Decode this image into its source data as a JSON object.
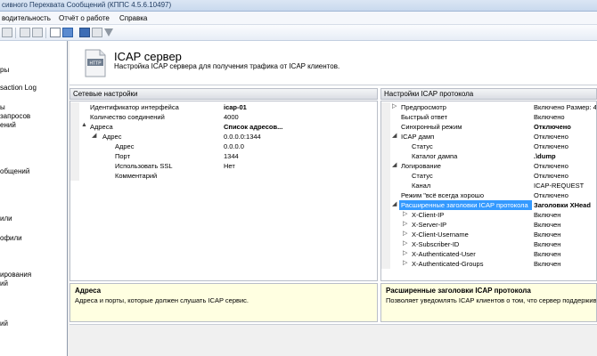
{
  "window": {
    "title": "сивного Перехвата Сообщений (КППС 4.5.6.10497)"
  },
  "menu": {
    "items": [
      "водительность",
      "Отчёт о работе",
      "Справка"
    ]
  },
  "leftnav": {
    "items": [
      "ры",
      "saction Log",
      "ы",
      "запросов",
      "ений",
      "общений",
      "или",
      "офили",
      "ирования",
      "ий",
      "ий"
    ]
  },
  "header": {
    "title": "ICAP сервер",
    "subtitle": "Настройка ICAP сервера для получения трафика от ICAP клиентов.",
    "icon_text": "HTTP"
  },
  "left_pane": {
    "title": "Сетевые настройки",
    "rows": [
      {
        "key": "Идентификатор интерфейса",
        "value": "icap-01",
        "bold": true
      },
      {
        "key": "Количество соединений",
        "value": "4000"
      },
      {
        "key": "Адреса",
        "value": "Список адресов...",
        "bold": true,
        "exp": "▲"
      },
      {
        "key": "Адрес",
        "value": "0.0.0.0:1344",
        "exp": "◢"
      },
      {
        "key": "Адрес",
        "value": "0.0.0.0"
      },
      {
        "key": "Порт",
        "value": "1344"
      },
      {
        "key": "Использовать SSL",
        "value": "Нет"
      },
      {
        "key": "Комментарий",
        "value": ""
      }
    ],
    "desc_title": "Адреса",
    "desc_text": "Адреса и порты, которые должен слушать ICAP сервис."
  },
  "right_pane": {
    "title": "Настройки ICAP протокола",
    "rows": [
      {
        "key": "Предпросмотр",
        "value": "Включено Размер: 4",
        "exp": "▷"
      },
      {
        "key": "Быстрый ответ",
        "value": "Включено"
      },
      {
        "key": "Синхронный режим",
        "value": "Отключено",
        "bold": true
      },
      {
        "key": "ICAP дамп",
        "value": "Отключено",
        "exp": "◢"
      },
      {
        "key": "Статус",
        "value": "Отключено"
      },
      {
        "key": "Каталог дампа",
        "value": ".\\dump",
        "bold": true
      },
      {
        "key": "Логирование",
        "value": "Отключено",
        "exp": "◢"
      },
      {
        "key": "Статус",
        "value": "Отключено"
      },
      {
        "key": "Канал",
        "value": "ICAP-REQUEST"
      },
      {
        "key": "Режим \"всё всегда хорошо",
        "value": "Отключено"
      },
      {
        "key": "Расширенные заголовки ICAP протокола",
        "value": "Заголовки XHead",
        "bold": true,
        "exp": "◢",
        "selected": true
      },
      {
        "key": "X-Client-IP",
        "value": "Включен",
        "exp": "▷"
      },
      {
        "key": "X-Server-IP",
        "value": "Включен",
        "exp": "▷"
      },
      {
        "key": "X-Client-Username",
        "value": "Включен",
        "exp": "▷"
      },
      {
        "key": "X-Subscriber-ID",
        "value": "Включен",
        "exp": "▷"
      },
      {
        "key": "X-Authenticated-User",
        "value": "Включен",
        "exp": "▷"
      },
      {
        "key": "X-Authenticated-Groups",
        "value": "Включен",
        "exp": "▷"
      }
    ],
    "desc_title": "Расширенные заголовки ICAP протокола",
    "desc_text": "Позволяет уведомлять ICAP клиентов о том, что сервер поддержива"
  },
  "colors": {
    "selection": "#3399ff",
    "desc_bg": "#ffffe1",
    "accent": "#2b5fa8"
  }
}
